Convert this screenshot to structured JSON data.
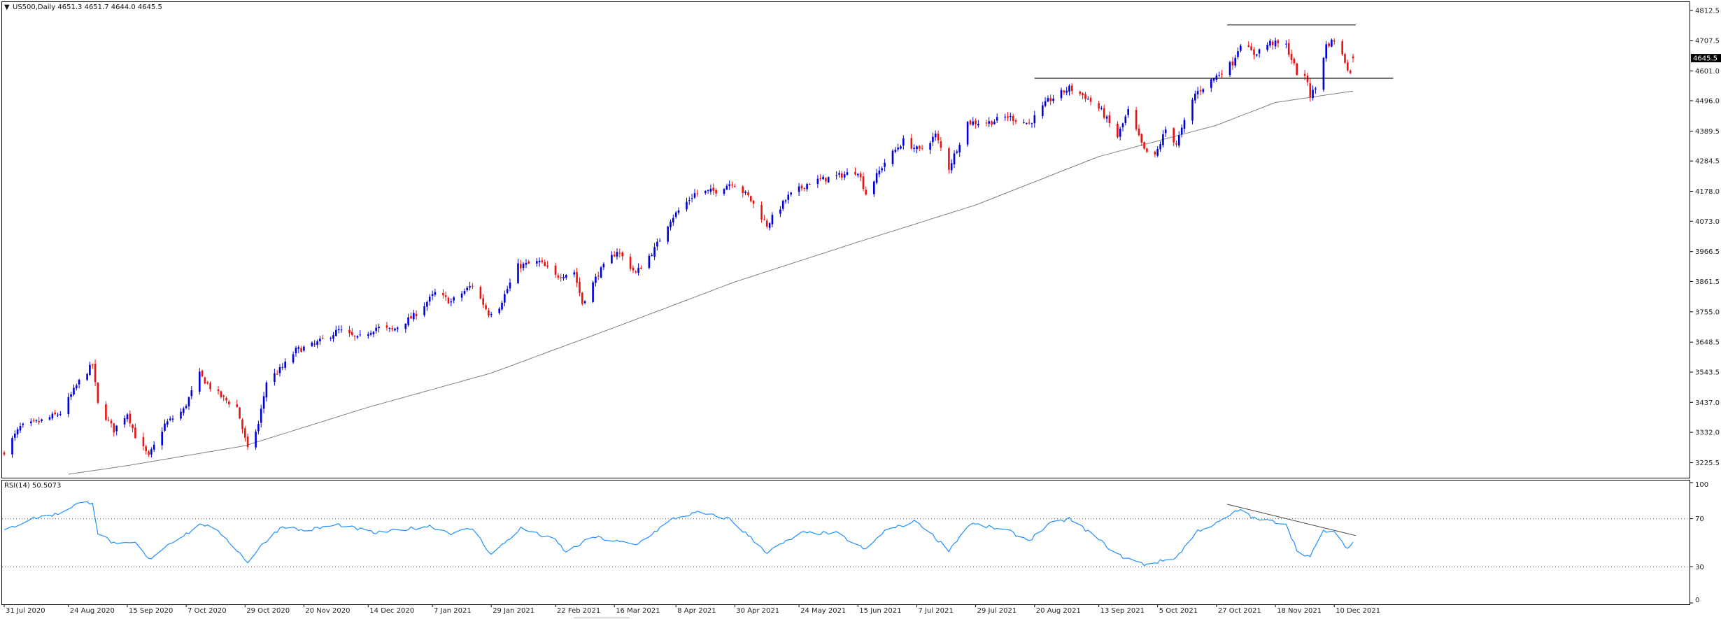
{
  "header": {
    "arrow": "▼",
    "label": "US500,Daily  4651.3 4651.7 4644.0 4645.5"
  },
  "price_panel": {
    "current_price_label": "4645.5",
    "y_ticks": [
      "4812.5",
      "4707.5",
      "4601.0",
      "4496.0",
      "4389.5",
      "4284.5",
      "4178.0",
      "4073.0",
      "3966.5",
      "3861.5",
      "3755.0",
      "3648.5",
      "3543.5",
      "3437.0",
      "3332.0",
      "3225.5"
    ]
  },
  "rsi_panel": {
    "label": "RSI(14) 50.5073",
    "y_ticks": [
      "100",
      "70",
      "30",
      "0"
    ]
  },
  "x_labels": [
    "31 Jul 2020",
    "24 Aug 2020",
    "15 Sep 2020",
    "7 Oct 2020",
    "29 Oct 2020",
    "20 Nov 2020",
    "14 Dec 2020",
    "7 Jan 2021",
    "29 Jan 2021",
    "22 Feb 2021",
    "16 Mar 2021",
    "8 Apr 2021",
    "30 Apr 2021",
    "24 May 2021",
    "15 Jun 2021",
    "7 Jul 2021",
    "29 Jul 2021",
    "20 Aug 2021",
    "13 Sep 2021",
    "5 Oct 2021",
    "27 Oct 2021",
    "18 Nov 2021",
    "10 Dec 2021"
  ],
  "colors": {
    "bull": "#0000dd",
    "bear": "#ee1111",
    "ma": "#808080",
    "rsi": "#1e90ff",
    "levels": "#ee2222",
    "lines": "#000000"
  },
  "chart_data": [
    {
      "type": "candlestick",
      "symbol": "US500",
      "timeframe": "Daily",
      "ohlc_last": {
        "open": 4651.3,
        "high": 4651.7,
        "low": 4644.0,
        "close": 4645.5
      },
      "ylim": [
        3180,
        4830
      ],
      "x_start": "2020-07-31",
      "x_end": "2021-12-17",
      "close_anchors": [
        [
          "2020-07-31",
          3265
        ],
        [
          "2020-08-06",
          3350
        ],
        [
          "2020-08-14",
          3372
        ],
        [
          "2020-08-21",
          3400
        ],
        [
          "2020-08-28",
          3510
        ],
        [
          "2020-09-02",
          3570
        ],
        [
          "2020-09-04",
          3430
        ],
        [
          "2020-09-10",
          3340
        ],
        [
          "2020-09-15",
          3400
        ],
        [
          "2020-09-18",
          3320
        ],
        [
          "2020-09-23",
          3245
        ],
        [
          "2020-09-29",
          3360
        ],
        [
          "2020-10-06",
          3410
        ],
        [
          "2020-10-12",
          3535
        ],
        [
          "2020-10-16",
          3490
        ],
        [
          "2020-10-21",
          3450
        ],
        [
          "2020-10-26",
          3420
        ],
        [
          "2020-10-30",
          3270
        ],
        [
          "2020-11-03",
          3360
        ],
        [
          "2020-11-06",
          3510
        ],
        [
          "2020-11-12",
          3560
        ],
        [
          "2020-11-17",
          3620
        ],
        [
          "2020-11-24",
          3640
        ],
        [
          "2020-12-03",
          3690
        ],
        [
          "2020-12-10",
          3660
        ],
        [
          "2020-12-17",
          3700
        ],
        [
          "2020-12-23",
          3690
        ],
        [
          "2020-12-31",
          3740
        ],
        [
          "2021-01-08",
          3820
        ],
        [
          "2021-01-14",
          3790
        ],
        [
          "2021-01-22",
          3850
        ],
        [
          "2021-01-28",
          3750
        ],
        [
          "2021-02-01",
          3775
        ],
        [
          "2021-02-08",
          3915
        ],
        [
          "2021-02-16",
          3930
        ],
        [
          "2021-02-22",
          3880
        ],
        [
          "2021-03-01",
          3895
        ],
        [
          "2021-03-04",
          3785
        ],
        [
          "2021-03-10",
          3890
        ],
        [
          "2021-03-17",
          3970
        ],
        [
          "2021-03-24",
          3890
        ],
        [
          "2021-03-31",
          3975
        ],
        [
          "2021-04-06",
          4080
        ],
        [
          "2021-04-15",
          4170
        ],
        [
          "2021-04-23",
          4180
        ],
        [
          "2021-04-29",
          4210
        ],
        [
          "2021-05-05",
          4160
        ],
        [
          "2021-05-12",
          4060
        ],
        [
          "2021-05-20",
          4160
        ],
        [
          "2021-05-28",
          4210
        ],
        [
          "2021-06-07",
          4230
        ],
        [
          "2021-06-15",
          4250
        ],
        [
          "2021-06-18",
          4170
        ],
        [
          "2021-06-25",
          4280
        ],
        [
          "2021-07-02",
          4355
        ],
        [
          "2021-07-08",
          4320
        ],
        [
          "2021-07-14",
          4375
        ],
        [
          "2021-07-19",
          4260
        ],
        [
          "2021-07-26",
          4420
        ],
        [
          "2021-08-03",
          4420
        ],
        [
          "2021-08-10",
          4440
        ],
        [
          "2021-08-18",
          4415
        ],
        [
          "2021-08-25",
          4495
        ],
        [
          "2021-09-02",
          4540
        ],
        [
          "2021-09-08",
          4510
        ],
        [
          "2021-09-14",
          4460
        ],
        [
          "2021-09-20",
          4370
        ],
        [
          "2021-09-24",
          4460
        ],
        [
          "2021-09-30",
          4320
        ],
        [
          "2021-10-04",
          4300
        ],
        [
          "2021-10-08",
          4395
        ],
        [
          "2021-10-12",
          4345
        ],
        [
          "2021-10-19",
          4520
        ],
        [
          "2021-10-26",
          4575
        ],
        [
          "2021-11-02",
          4630
        ],
        [
          "2021-11-05",
          4700
        ],
        [
          "2021-11-10",
          4660
        ],
        [
          "2021-11-16",
          4700
        ],
        [
          "2021-11-22",
          4690
        ],
        [
          "2021-11-26",
          4595
        ],
        [
          "2021-11-30",
          4565
        ],
        [
          "2021-12-01",
          4515
        ],
        [
          "2021-12-03",
          4540
        ],
        [
          "2021-12-07",
          4690
        ],
        [
          "2021-12-10",
          4710
        ],
        [
          "2021-12-14",
          4635
        ],
        [
          "2021-12-16",
          4590
        ],
        [
          "2021-12-17",
          4645.5
        ]
      ],
      "moving_average_anchors": [
        [
          "2020-08-24",
          3185
        ],
        [
          "2020-09-15",
          3215
        ],
        [
          "2020-10-29",
          3285
        ],
        [
          "2020-12-14",
          3420
        ],
        [
          "2021-01-29",
          3540
        ],
        [
          "2021-03-16",
          3700
        ],
        [
          "2021-04-30",
          3860
        ],
        [
          "2021-06-15",
          4000
        ],
        [
          "2021-07-29",
          4130
        ],
        [
          "2021-09-13",
          4300
        ],
        [
          "2021-10-27",
          4410
        ],
        [
          "2021-11-18",
          4490
        ],
        [
          "2021-12-17",
          4530
        ]
      ],
      "horizontal_lines": [
        {
          "y": 4575,
          "from": "2021-08-20",
          "to": "2022-01-01"
        },
        {
          "y": 4762,
          "from": "2021-10-31",
          "to": "2021-12-18"
        }
      ]
    },
    {
      "type": "line",
      "title": "RSI(14) 50.5073",
      "ylim": [
        0,
        100
      ],
      "levels": [
        70,
        30
      ],
      "rsi_anchors": [
        [
          "2020-07-31",
          60
        ],
        [
          "2020-08-10",
          70
        ],
        [
          "2020-08-20",
          74
        ],
        [
          "2020-08-27",
          82
        ],
        [
          "2020-09-02",
          84
        ],
        [
          "2020-09-04",
          58
        ],
        [
          "2020-09-11",
          48
        ],
        [
          "2020-09-18",
          50
        ],
        [
          "2020-09-23",
          36
        ],
        [
          "2020-10-01",
          50
        ],
        [
          "2020-10-09",
          60
        ],
        [
          "2020-10-13",
          66
        ],
        [
          "2020-10-21",
          56
        ],
        [
          "2020-10-30",
          34
        ],
        [
          "2020-11-05",
          50
        ],
        [
          "2020-11-12",
          64
        ],
        [
          "2020-11-20",
          60
        ],
        [
          "2020-12-03",
          65
        ],
        [
          "2020-12-17",
          58
        ],
        [
          "2021-01-06",
          64
        ],
        [
          "2021-01-14",
          58
        ],
        [
          "2021-01-22",
          62
        ],
        [
          "2021-01-29",
          40
        ],
        [
          "2021-02-09",
          62
        ],
        [
          "2021-02-22",
          52
        ],
        [
          "2021-02-26",
          42
        ],
        [
          "2021-03-08",
          55
        ],
        [
          "2021-03-24",
          48
        ],
        [
          "2021-04-07",
          70
        ],
        [
          "2021-04-16",
          75
        ],
        [
          "2021-04-28",
          70
        ],
        [
          "2021-05-12",
          42
        ],
        [
          "2021-05-25",
          58
        ],
        [
          "2021-06-07",
          58
        ],
        [
          "2021-06-18",
          44
        ],
        [
          "2021-06-25",
          60
        ],
        [
          "2021-07-07",
          68
        ],
        [
          "2021-07-19",
          44
        ],
        [
          "2021-07-27",
          66
        ],
        [
          "2021-08-10",
          60
        ],
        [
          "2021-08-18",
          52
        ],
        [
          "2021-08-25",
          65
        ],
        [
          "2021-09-02",
          70
        ],
        [
          "2021-09-10",
          58
        ],
        [
          "2021-09-20",
          40
        ],
        [
          "2021-09-30",
          32
        ],
        [
          "2021-10-05",
          34
        ],
        [
          "2021-10-12",
          38
        ],
        [
          "2021-10-20",
          60
        ],
        [
          "2021-10-27",
          66
        ],
        [
          "2021-11-05",
          78
        ],
        [
          "2021-11-10",
          70
        ],
        [
          "2021-11-16",
          68
        ],
        [
          "2021-11-22",
          66
        ],
        [
          "2021-11-26",
          44
        ],
        [
          "2021-12-01",
          38
        ],
        [
          "2021-12-06",
          60
        ],
        [
          "2021-12-10",
          58
        ],
        [
          "2021-12-13",
          51
        ],
        [
          "2021-12-15",
          45
        ],
        [
          "2021-12-17",
          50.5073
        ]
      ],
      "trendline": {
        "from": [
          "2021-10-31",
          82
        ],
        "to": [
          "2021-12-18",
          56
        ]
      }
    }
  ]
}
